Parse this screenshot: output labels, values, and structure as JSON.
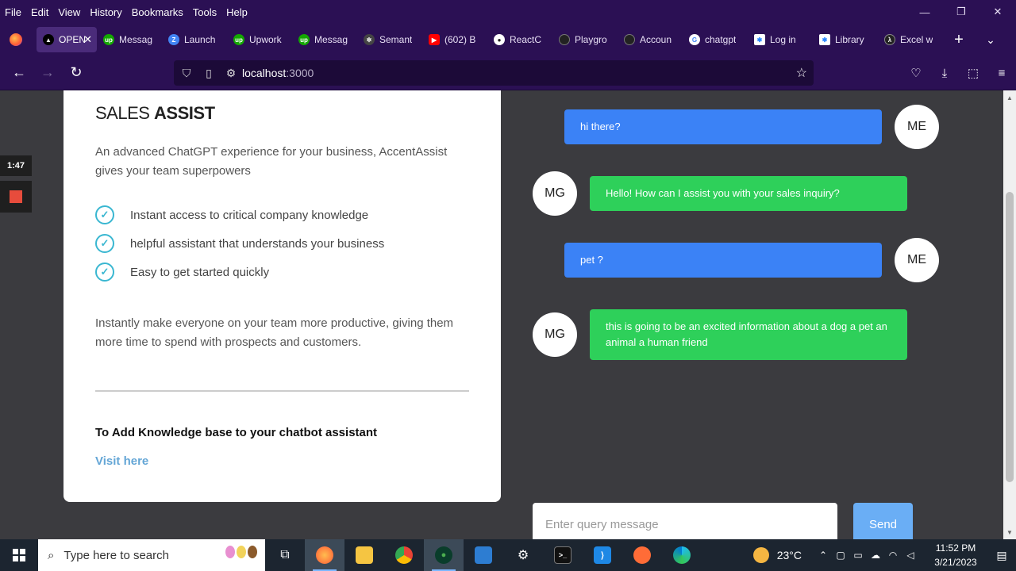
{
  "menu": {
    "items": [
      "File",
      "Edit",
      "View",
      "History",
      "Bookmarks",
      "Tools",
      "Help"
    ]
  },
  "window_controls": {
    "minimize": "—",
    "restore": "❐",
    "close": "✕"
  },
  "tabs": [
    {
      "label": "OPEN",
      "favicon": "openai-icon",
      "color": "#000000",
      "active": true
    },
    {
      "label": "Messag",
      "favicon": "upwork-icon",
      "color": "#14a800"
    },
    {
      "label": "Launch",
      "favicon": "zapier-icon",
      "color": "#4285f4"
    },
    {
      "label": "Upwork",
      "favicon": "upwork-icon",
      "color": "#14a800"
    },
    {
      "label": "Messag",
      "favicon": "upwork-icon",
      "color": "#14a800"
    },
    {
      "label": "Semant",
      "favicon": "semantic-icon",
      "color": "#444444"
    },
    {
      "label": "(602) B",
      "favicon": "youtube-icon",
      "color": "#ff0000"
    },
    {
      "label": "ReactC",
      "favicon": "github-icon",
      "color": "#222222"
    },
    {
      "label": "Playgro",
      "favicon": "openai-icon",
      "color": "#222222"
    },
    {
      "label": "Accoun",
      "favicon": "openai-icon",
      "color": "#222222"
    },
    {
      "label": "chatgpt",
      "favicon": "google-icon",
      "color": "#ffffff"
    },
    {
      "label": "Log in",
      "favicon": "confluence-icon",
      "color": "#2684ff"
    },
    {
      "label": "Library",
      "favicon": "confluence-icon",
      "color": "#2684ff"
    },
    {
      "label": "Excel w",
      "favicon": "lambda-icon",
      "color": "#222222"
    }
  ],
  "url": {
    "host": "localhost",
    "port": ":3000"
  },
  "card": {
    "title_light": "SALES ",
    "title_bold": "ASSIST",
    "description": "An advanced ChatGPT experience for your business, AccentAssist gives your team superpowers",
    "features": [
      "Instant access to critical company knowledge",
      "helpful assistant that understands your business",
      "Easy to get started quickly"
    ],
    "description2": "Instantly make everyone on your team more productive, giving them more time to spend with prospects and customers.",
    "kb_title": "To Add Knowledge base to your chatbot assistant",
    "kb_link": "Visit here"
  },
  "chat": {
    "messages": [
      {
        "from": "ME",
        "text": "hi there?"
      },
      {
        "from": "MG",
        "text": "Hello! How can I assist you with your sales inquiry?"
      },
      {
        "from": "ME",
        "text": "pet ?"
      },
      {
        "from": "MG",
        "text": "this is going to be an excited information about a dog a pet an animal a human friend"
      }
    ],
    "input_placeholder": "Enter query message",
    "send_label": "Send"
  },
  "recorder": {
    "time": "1:47"
  },
  "taskbar": {
    "search_placeholder": "Type here to search",
    "weather": "23°C",
    "time": "11:52 PM",
    "date": "3/21/2023"
  }
}
